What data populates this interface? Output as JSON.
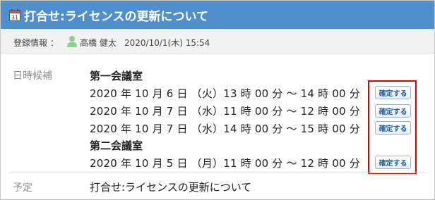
{
  "header": {
    "title": "打合せ:ライセンスの更新について",
    "calendar_icon_day": "31"
  },
  "registration": {
    "label": "登録情報 ：",
    "user_name": "高橋 健太",
    "datetime": "2020/10/1(木) 15:54"
  },
  "candidates": {
    "label": "日時候補",
    "rooms": [
      {
        "name": "第一会議室",
        "slots": [
          {
            "text": "2020 年 10 月 6 日 （火）13 時 00 分 ～ 14 時 00 分",
            "button": "確定する"
          },
          {
            "text": "2020 年 10 月 7 日 （水）11 時 00 分 ～ 12 時 00 分",
            "button": "確定する"
          },
          {
            "text": "2020 年 10 月 7 日 （水）14 時 00 分 ～ 15 時 00 分",
            "button": "確定する"
          }
        ]
      },
      {
        "name": "第二会議室",
        "slots": [
          {
            "text": "2020 年 10 月 5 日 （月）11 時 00 分 ～ 12 時 00 分",
            "button": "確定する"
          }
        ]
      }
    ]
  },
  "schedule": {
    "label": "予定",
    "value": "打合せ:ライセンスの更新について"
  },
  "colors": {
    "title_bar": "#4f8fcb",
    "highlight_box": "#e00000",
    "button_text": "#1f5fa8",
    "user_icon": "#8fd08f"
  }
}
